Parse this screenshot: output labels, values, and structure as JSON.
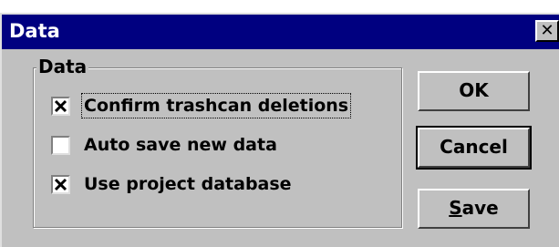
{
  "window": {
    "title": "Data",
    "close_glyph": "✕"
  },
  "group": {
    "title": "Data"
  },
  "options": [
    {
      "label": "Confirm trashcan deletions",
      "checked": true
    },
    {
      "label": "Auto save new data",
      "checked": false
    },
    {
      "label": "Use project database",
      "checked": true
    }
  ],
  "buttons": {
    "ok_label": "OK",
    "cancel_label": "Cancel",
    "save_accel": "S",
    "save_rest": "ave"
  },
  "colors": {
    "titlebar": "#000080",
    "face": "#c0c0c0",
    "title_text": "#ffffff"
  },
  "icons": {
    "close": "close-icon",
    "check": "checkmark-icon"
  }
}
